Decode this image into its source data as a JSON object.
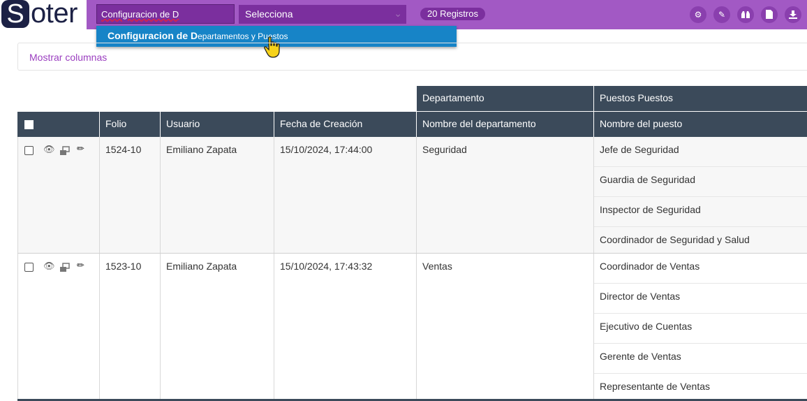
{
  "brand": {
    "logo_letter": "S",
    "logo_rest": "oter"
  },
  "toolbar": {
    "search_value": "Configuracion de D",
    "select_value": "Selecciona",
    "records_badge": "20 Registros",
    "buttons": [
      "gear-icon",
      "pencil-icon",
      "binoculars-icon",
      "document-icon",
      "download-icon"
    ]
  },
  "autocomplete": {
    "match": "Configuracion de D",
    "rest": "epartamentos y Puestos"
  },
  "panel": {
    "show_columns": "Mostrar columnas"
  },
  "table": {
    "group_headers": {
      "department": "Departamento",
      "positions": "Puestos Puestos"
    },
    "headers": {
      "folio": "Folio",
      "user": "Usuario",
      "created": "Fecha de Creación",
      "dept_name": "Nombre del departamento",
      "position_name": "Nombre del puesto"
    },
    "rows": [
      {
        "folio": "1524-10",
        "user": "Emiliano Zapata",
        "created": "15/10/2024, 17:44:00",
        "department": "Seguridad",
        "positions": [
          "Jefe de Seguridad",
          "Guardia de Seguridad",
          "Inspector de Seguridad",
          "Coordinador de Seguridad y Salud"
        ]
      },
      {
        "folio": "1523-10",
        "user": "Emiliano Zapata",
        "created": "15/10/2024, 17:43:32",
        "department": "Ventas",
        "positions": [
          "Coordinador de Ventas",
          "Director de Ventas",
          "Ejecutivo de Cuentas",
          "Gerente de Ventas",
          "Representante de Ventas"
        ]
      }
    ]
  },
  "colors": {
    "accent": "#a259c4",
    "accent_dark": "#7b2f9e",
    "header": "#3b4a5a",
    "dropdown": "#1784c7",
    "link": "#9b3fc0"
  }
}
